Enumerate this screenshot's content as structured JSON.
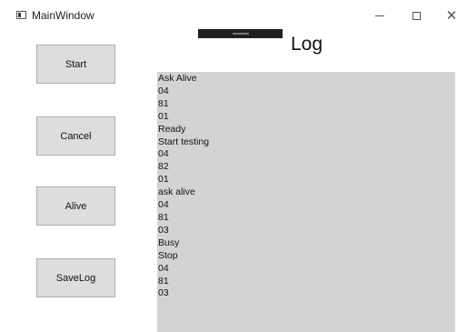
{
  "window": {
    "title": "MainWindow",
    "controls": {
      "minimize": "minimize",
      "maximize": "maximize",
      "close": "close"
    }
  },
  "progress": {
    "value": 1.0
  },
  "log": {
    "heading": "Log",
    "lines": [
      "Ask Alive",
      "04",
      "81",
      "01",
      "Ready",
      "Start testing",
      "04",
      "82",
      "01",
      "ask alive",
      "04",
      "81",
      "03",
      "Busy",
      "Stop",
      "04",
      "81",
      "03"
    ]
  },
  "buttons": {
    "start": "Start",
    "cancel": "Cancel",
    "alive": "Alive",
    "savelog": "SaveLog"
  },
  "colors": {
    "log_background": "#d3d3d3",
    "button_background": "#dddddd",
    "button_border": "#adadad",
    "progress_fill": "#1f1f1f"
  }
}
